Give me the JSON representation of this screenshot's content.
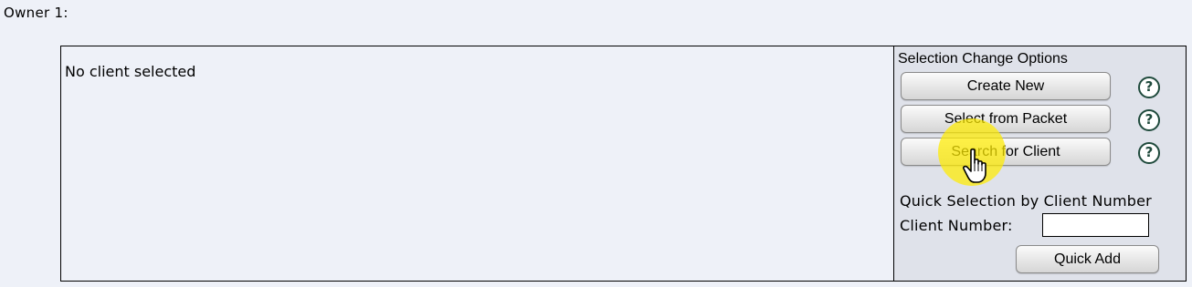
{
  "owner": {
    "label": "Owner 1:"
  },
  "client_panel": {
    "status_text": "No client selected"
  },
  "selection_options": {
    "title": "Selection Change Options",
    "buttons": [
      {
        "label": "Create New",
        "help_icon": "question-circle-icon"
      },
      {
        "label": "Select from Packet",
        "help_icon": "question-circle-icon"
      },
      {
        "label": "Search for Client",
        "help_icon": "question-circle-icon"
      }
    ],
    "help_glyph": "?"
  },
  "quick_selection": {
    "title": "Quick Selection by Client Number",
    "client_number_label": "Client Number:",
    "client_number_value": "",
    "quick_add_label": "Quick Add"
  },
  "colors": {
    "page_background": "#eef1f8",
    "options_background": "#dfe2ea",
    "help_icon": "#1f4a3c",
    "cursor_highlight": "#ffeb00"
  },
  "cursor": {
    "icon": "hand-pointer-icon"
  }
}
